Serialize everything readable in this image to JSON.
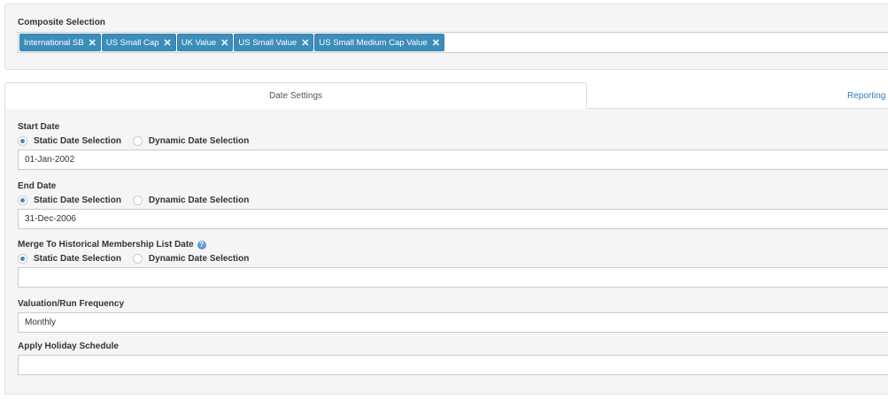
{
  "composite": {
    "label": "Composite Selection",
    "tags": [
      "International SB",
      "US Small Cap",
      "UK Value",
      "US Small Value",
      "US Small Medium Cap Value"
    ],
    "remove_glyph": "✕"
  },
  "tabs": {
    "date_settings": "Date Settings",
    "reporting": "Reporting"
  },
  "start_date": {
    "label": "Start Date",
    "option_static": "Static Date Selection",
    "option_dynamic": "Dynamic Date Selection",
    "value": "01-Jan-2002"
  },
  "end_date": {
    "label": "End Date",
    "option_static": "Static Date Selection",
    "option_dynamic": "Dynamic Date Selection",
    "value": "31-Dec-2006"
  },
  "merge_date": {
    "label": "Merge To Historical Membership List Date",
    "help_glyph": "?",
    "option_static": "Static Date Selection",
    "option_dynamic": "Dynamic Date Selection",
    "value": ""
  },
  "frequency": {
    "label": "Valuation/Run Frequency",
    "value": "Monthly"
  },
  "holiday": {
    "label": "Apply Holiday Schedule",
    "value": ""
  },
  "colors": {
    "accent": "#3c8dbc",
    "link": "#337ab7"
  }
}
